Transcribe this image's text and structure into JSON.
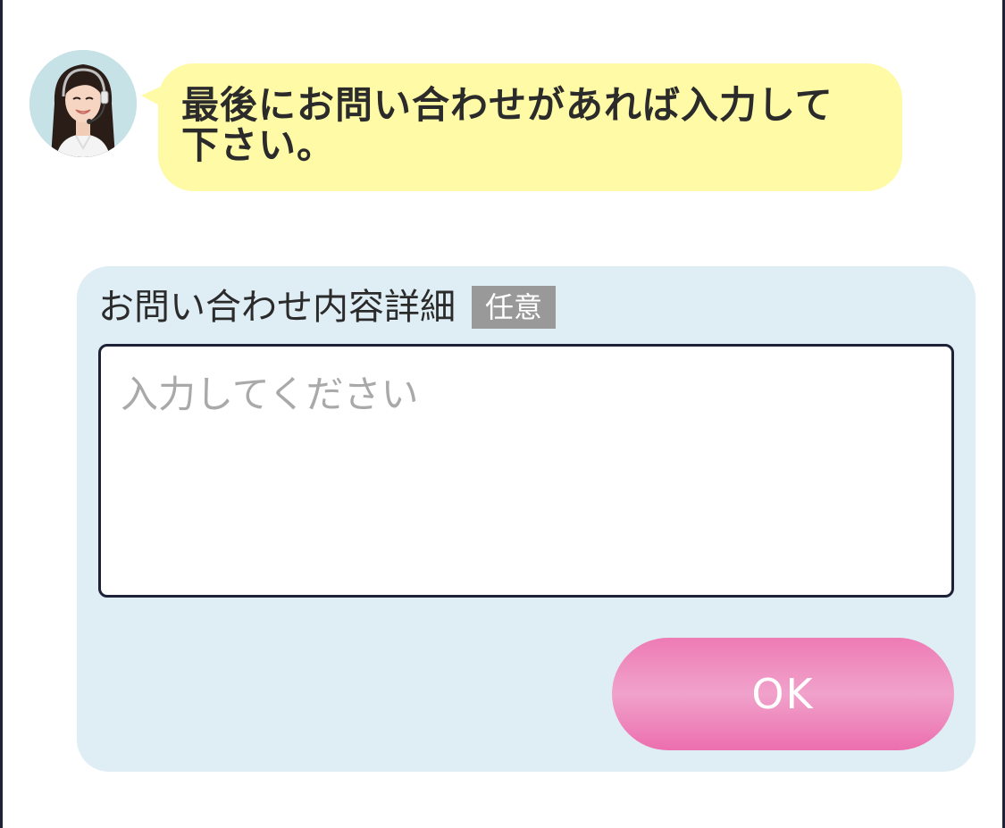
{
  "chat": {
    "operator_avatar_icon": "operator-headset-avatar",
    "message": "最後にお問い合わせがあれば入力して下さい。"
  },
  "form": {
    "field_label": "お問い合わせ内容詳細",
    "optional_badge": "任意",
    "textarea_placeholder": "入力してください",
    "textarea_value": "",
    "submit_label": "OK"
  },
  "colors": {
    "bubble": "#fffaa6",
    "panel": "#dfeef4",
    "button": "#ee7bb5",
    "badge": "#999999",
    "frame": "#1d2238"
  }
}
